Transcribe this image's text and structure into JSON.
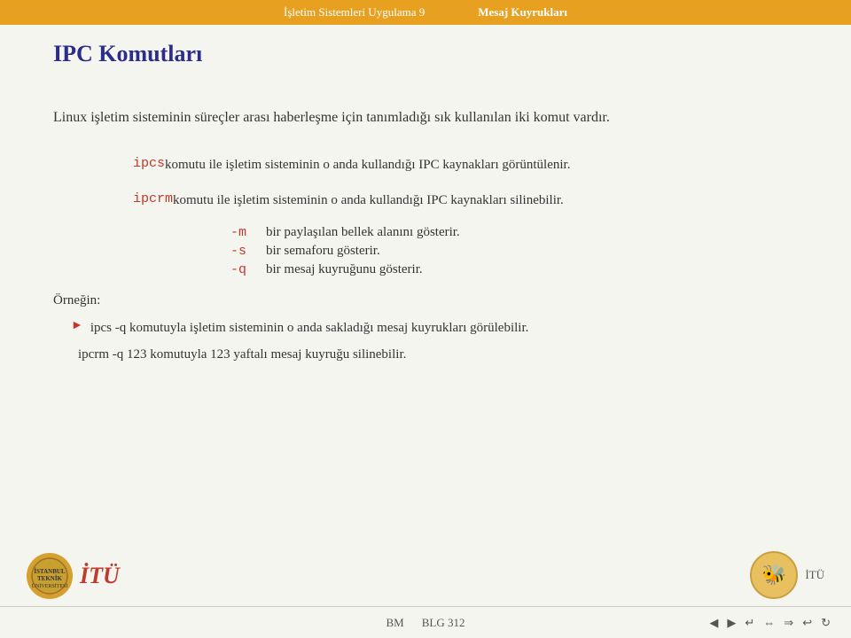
{
  "header": {
    "nav_item1": "İşletim Sistemleri Uygulama 9",
    "nav_item2": "Mesaj Kuyrukları"
  },
  "title": {
    "main": "IPC Komutları"
  },
  "content": {
    "intro": "Linux işletim sisteminin süreçler arası haberleşme için tanımladığı sık kullanılan iki komut vardır.",
    "ipcs_label": "ipcs",
    "ipcs_desc": "komutu ile işletim sisteminin o anda kullandığı IPC kaynakları görüntülenir.",
    "ipcrm_label": "ipcrm",
    "ipcrm_desc": "komutu ile işletim sisteminin o anda kullandığı IPC kaynakları silinebilir.",
    "opt_m_label": "-m",
    "opt_m_desc": "bir paylaşılan bellek alanını gösterir.",
    "opt_s_label": "-s",
    "opt_s_desc": "bir semaforu gösterir.",
    "opt_q_label": "-q",
    "opt_q_desc": "bir mesaj kuyruğunu gösterir.",
    "example_label": "Örneğin:",
    "example1": "ipcs -q komutuyla işletim sisteminin o anda sakladığı mesaj kuyrukları görülebilir.",
    "example2": "ipcrm -q 123 komutuyla 123 yaftalı mesaj kuyruğu silinebilir."
  },
  "footer": {
    "center_left": "BM",
    "center_right": "BLG 312",
    "itu_left_text": "İTÜ",
    "itu_right_text": "İTÜ"
  },
  "logos": {
    "left_text": "İTÜ",
    "right_text": "İTÜ",
    "bee_emoji": "🐝"
  }
}
